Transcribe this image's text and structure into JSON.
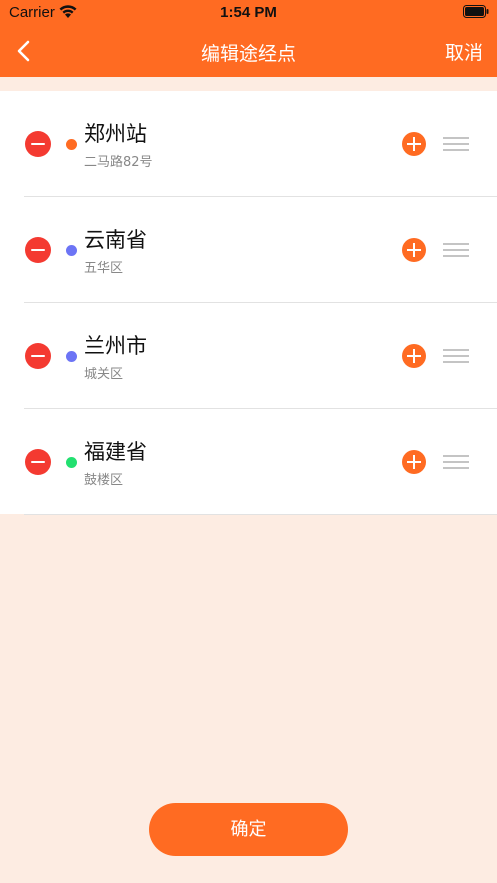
{
  "status_bar": {
    "carrier": "Carrier",
    "time": "1:54 PM"
  },
  "nav": {
    "title": "编辑途经点",
    "cancel_label": "取消"
  },
  "stops": [
    {
      "name": "郑州站",
      "detail": "二马路82号",
      "dot_color": "#ff6b22"
    },
    {
      "name": "云南省",
      "detail": "五华区",
      "dot_color": "#6c74f5"
    },
    {
      "name": "兰州市",
      "detail": "城关区",
      "dot_color": "#6c74f5"
    },
    {
      "name": "福建省",
      "detail": "鼓楼区",
      "dot_color": "#22e070"
    }
  ],
  "confirm_label": "确定",
  "colors": {
    "accent": "#ff6b22",
    "remove": "#f43a31",
    "background": "#fdece2"
  }
}
